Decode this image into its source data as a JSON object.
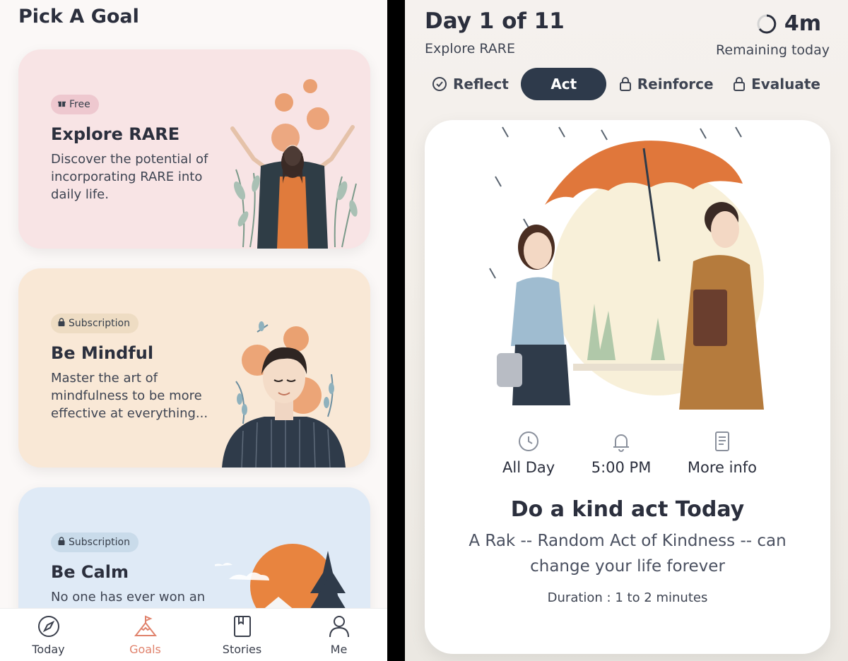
{
  "left": {
    "title": "Pick A Goal",
    "cards": [
      {
        "badge": "Free",
        "title": "Explore RARE",
        "desc": "Discover the potential of incorporating RARE into daily life."
      },
      {
        "badge": "Subscription",
        "title": "Be Mindful",
        "desc": "Master the art of mindfulness to be more effective at everything..."
      },
      {
        "badge": "Subscription",
        "title": "Be Calm",
        "desc": "No one has ever won an"
      }
    ],
    "tabs": [
      {
        "label": "Today",
        "icon": "compass-icon"
      },
      {
        "label": "Goals",
        "icon": "mountain-flag-icon"
      },
      {
        "label": "Stories",
        "icon": "book-icon"
      },
      {
        "label": "Me",
        "icon": "person-icon"
      }
    ],
    "active_tab_color": "#e0826c"
  },
  "right": {
    "day_label": "Day",
    "day_number": "1",
    "day_of": "of 11",
    "subtitle": "Explore RARE",
    "timer_value": "4m",
    "timer_label": "Remaining today",
    "steps": [
      {
        "label": "Reflect",
        "icon": "check-circle-icon",
        "state": "done"
      },
      {
        "label": "Act",
        "icon": "",
        "state": "active"
      },
      {
        "label": "Reinforce",
        "icon": "lock-icon",
        "state": "locked"
      },
      {
        "label": "Evaluate",
        "icon": "lock-icon",
        "state": "locked"
      }
    ],
    "info": [
      {
        "label": "All Day",
        "icon": "clock-icon"
      },
      {
        "label": "5:00 PM",
        "icon": "bell-icon"
      },
      {
        "label": "More info",
        "icon": "document-icon"
      }
    ],
    "act_title": "Do a kind act Today",
    "act_desc": "A Rak -- Random Act of Kindness -- can change your life forever",
    "duration": "Duration : 1 to 2 minutes",
    "accent": "#2e3a4b"
  }
}
